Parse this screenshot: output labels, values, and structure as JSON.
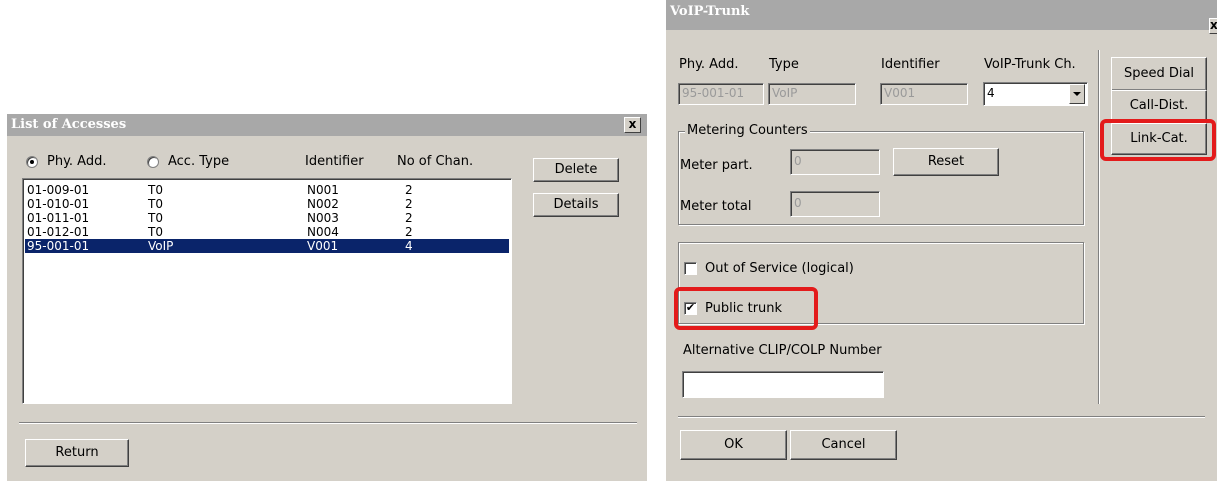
{
  "accesses_window": {
    "title": "List of Accesses",
    "close_symbol": "x",
    "radio_phy": "Phy. Add.",
    "radio_acc": "Acc. Type",
    "col_identifier": "Identifier",
    "col_channels": "No of Chan.",
    "rows": [
      {
        "phy": "01-009-01",
        "type": "T0",
        "id": "N001",
        "chan": "2"
      },
      {
        "phy": "01-010-01",
        "type": "T0",
        "id": "N002",
        "chan": "2"
      },
      {
        "phy": "01-011-01",
        "type": "T0",
        "id": "N003",
        "chan": "2"
      },
      {
        "phy": "01-012-01",
        "type": "T0",
        "id": "N004",
        "chan": "2"
      },
      {
        "phy": "95-001-01",
        "type": "VoIP",
        "id": "V001",
        "chan": "4"
      }
    ],
    "delete_label": "Delete",
    "details_label": "Details",
    "return_label": "Return"
  },
  "voip_window": {
    "title": "VoIP-Trunk",
    "close_symbol": "x",
    "hdr_phy": "Phy. Add.",
    "hdr_type": "Type",
    "hdr_identifier": "Identifier",
    "hdr_channel": "VoIP-Trunk Ch.",
    "val_phy": "95-001-01",
    "val_type": "VoIP",
    "val_identifier": "V001",
    "val_channel": "4",
    "metering_title": "Metering Counters",
    "meter_part_label": "Meter part.",
    "meter_part_value": "0",
    "meter_total_label": "Meter total",
    "meter_total_value": "0",
    "reset_label": "Reset",
    "out_of_service_label": "Out of Service (logical)",
    "public_trunk_label": "Public trunk",
    "public_trunk_mark": "✔",
    "alt_clip_label": "Alternative CLIP/COLP Number",
    "alt_clip_value": "",
    "ok_label": "OK",
    "cancel_label": "Cancel",
    "speed_dial_label": "Speed Dial",
    "call_dist_label": "Call-Dist.",
    "link_cat_label": "Link-Cat."
  },
  "colors": {
    "selection": "#0a246a",
    "highlight": "#e31b1b",
    "dialog_bg": "#d4d0c8"
  }
}
